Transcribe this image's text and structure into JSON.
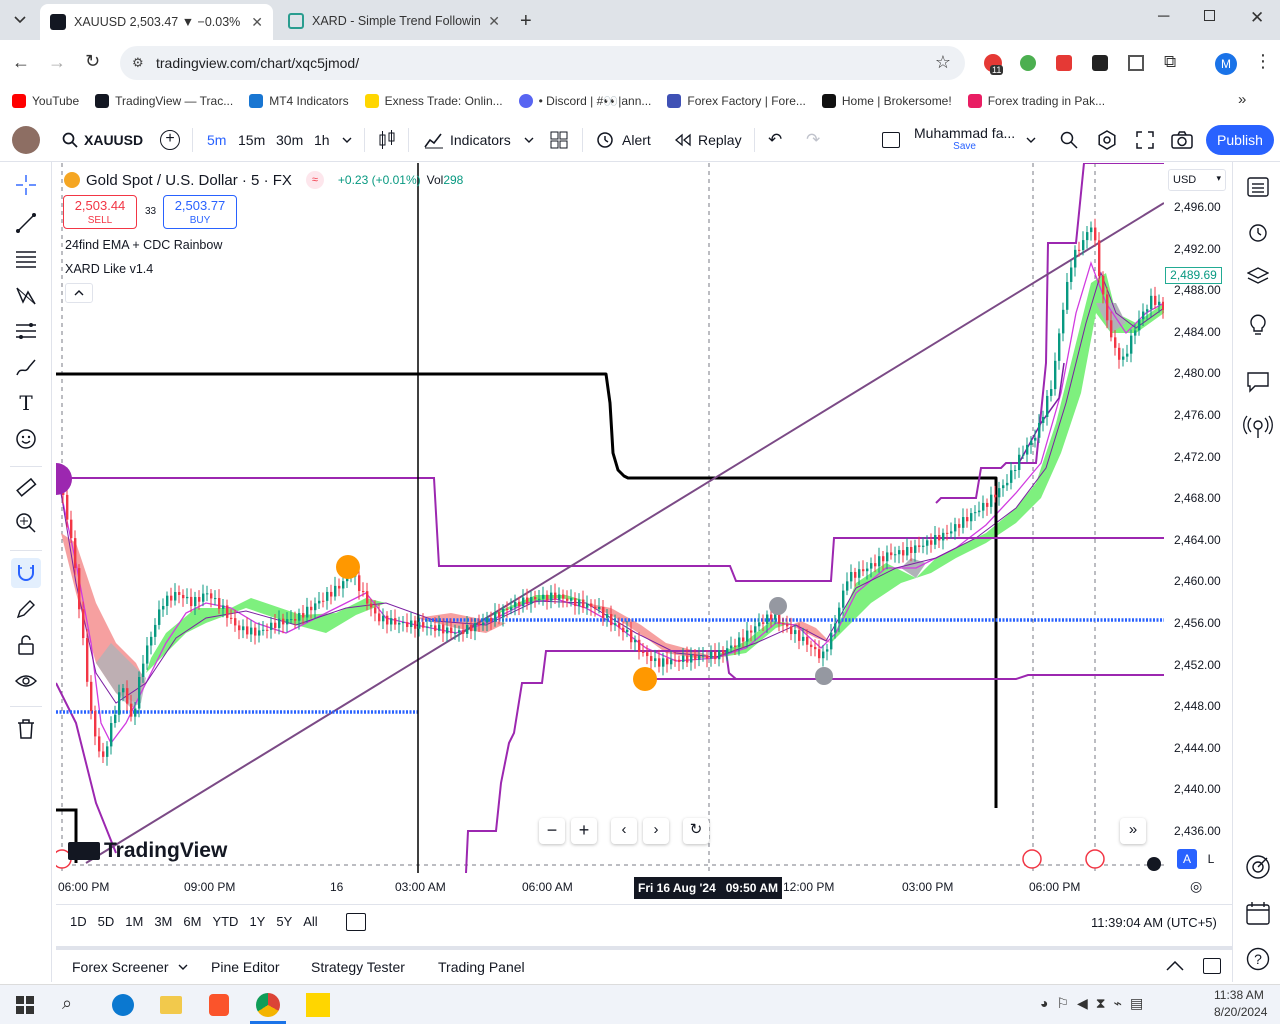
{
  "browser": {
    "tabs": [
      {
        "title": "XAUUSD 2,503.47 ▼ −0.03% M",
        "active": true
      },
      {
        "title": "XARD - Simple Trend Following",
        "active": false
      }
    ],
    "url": "tradingview.com/chart/xqc5jmod/",
    "extension_badge": "11",
    "profile_initial": "M",
    "bookmarks": [
      "YouTube",
      "TradingView — Trac...",
      "MT4 Indicators",
      "Exness Trade: Onlin...",
      "• Discord | #👀|ann...",
      "Forex Factory | Fore...",
      "Home | Brokersome!",
      "Forex trading in Pak..."
    ]
  },
  "toolbar": {
    "symbol": "XAUUSD",
    "intervals": [
      "5m",
      "15m",
      "30m",
      "1h"
    ],
    "active_interval": "5m",
    "indicators_label": "Indicators",
    "alert_label": "Alert",
    "replay_label": "Replay",
    "layout_name": "Muhammad fa...",
    "layout_sub": "Save",
    "publish_label": "Publish"
  },
  "legend": {
    "title": "Gold Spot / U.S. Dollar · 5 · FX",
    "change": "+0.23 (+0.01%)",
    "vol_label": "Vol",
    "vol_value": "298",
    "sell_price": "2,503.44",
    "sell_label": "SELL",
    "spread": "33",
    "buy_price": "2,503.77",
    "buy_label": "BUY",
    "indicator1": "24find EMA + CDC Rainbow",
    "indicator2": "XARD Like v1.4"
  },
  "price_axis": {
    "currency": "USD",
    "ticks": [
      "2,496.00",
      "2,492.00",
      "2,488.00",
      "2,484.00",
      "2,480.00",
      "2,476.00",
      "2,472.00",
      "2,468.00",
      "2,464.00",
      "2,460.00",
      "2,456.00",
      "2,452.00",
      "2,448.00",
      "2,444.00",
      "2,440.00",
      "2,436.00"
    ],
    "last_price": "2,489.69"
  },
  "time_axis": {
    "ticks": [
      "06:00 PM",
      "09:00 PM",
      "16",
      "03:00 AM",
      "06:00 AM",
      "12:00 PM",
      "03:00 PM",
      "06:00 PM"
    ],
    "crosshair_label": "Fri 16 Aug '24   09:50 AM"
  },
  "watermark": "TradingView",
  "range_bar": {
    "ranges": [
      "1D",
      "5D",
      "1M",
      "3M",
      "6M",
      "YTD",
      "1Y",
      "5Y",
      "All"
    ],
    "clock": "11:39:04 AM (UTC+5)"
  },
  "bottom_tabs": [
    "Forex Screener",
    "Pine Editor",
    "Strategy Tester",
    "Trading Panel"
  ],
  "axis_mode": {
    "auto": "A",
    "log": "L"
  },
  "taskbar": {
    "time": "11:38 AM",
    "date": "8/20/2024"
  },
  "colors": {
    "accent": "#2962ff",
    "up": "#089981",
    "down": "#f23645",
    "purple": "#9c27b0",
    "channel_green": "#7ef07e",
    "channel_red": "#f48f8f"
  }
}
